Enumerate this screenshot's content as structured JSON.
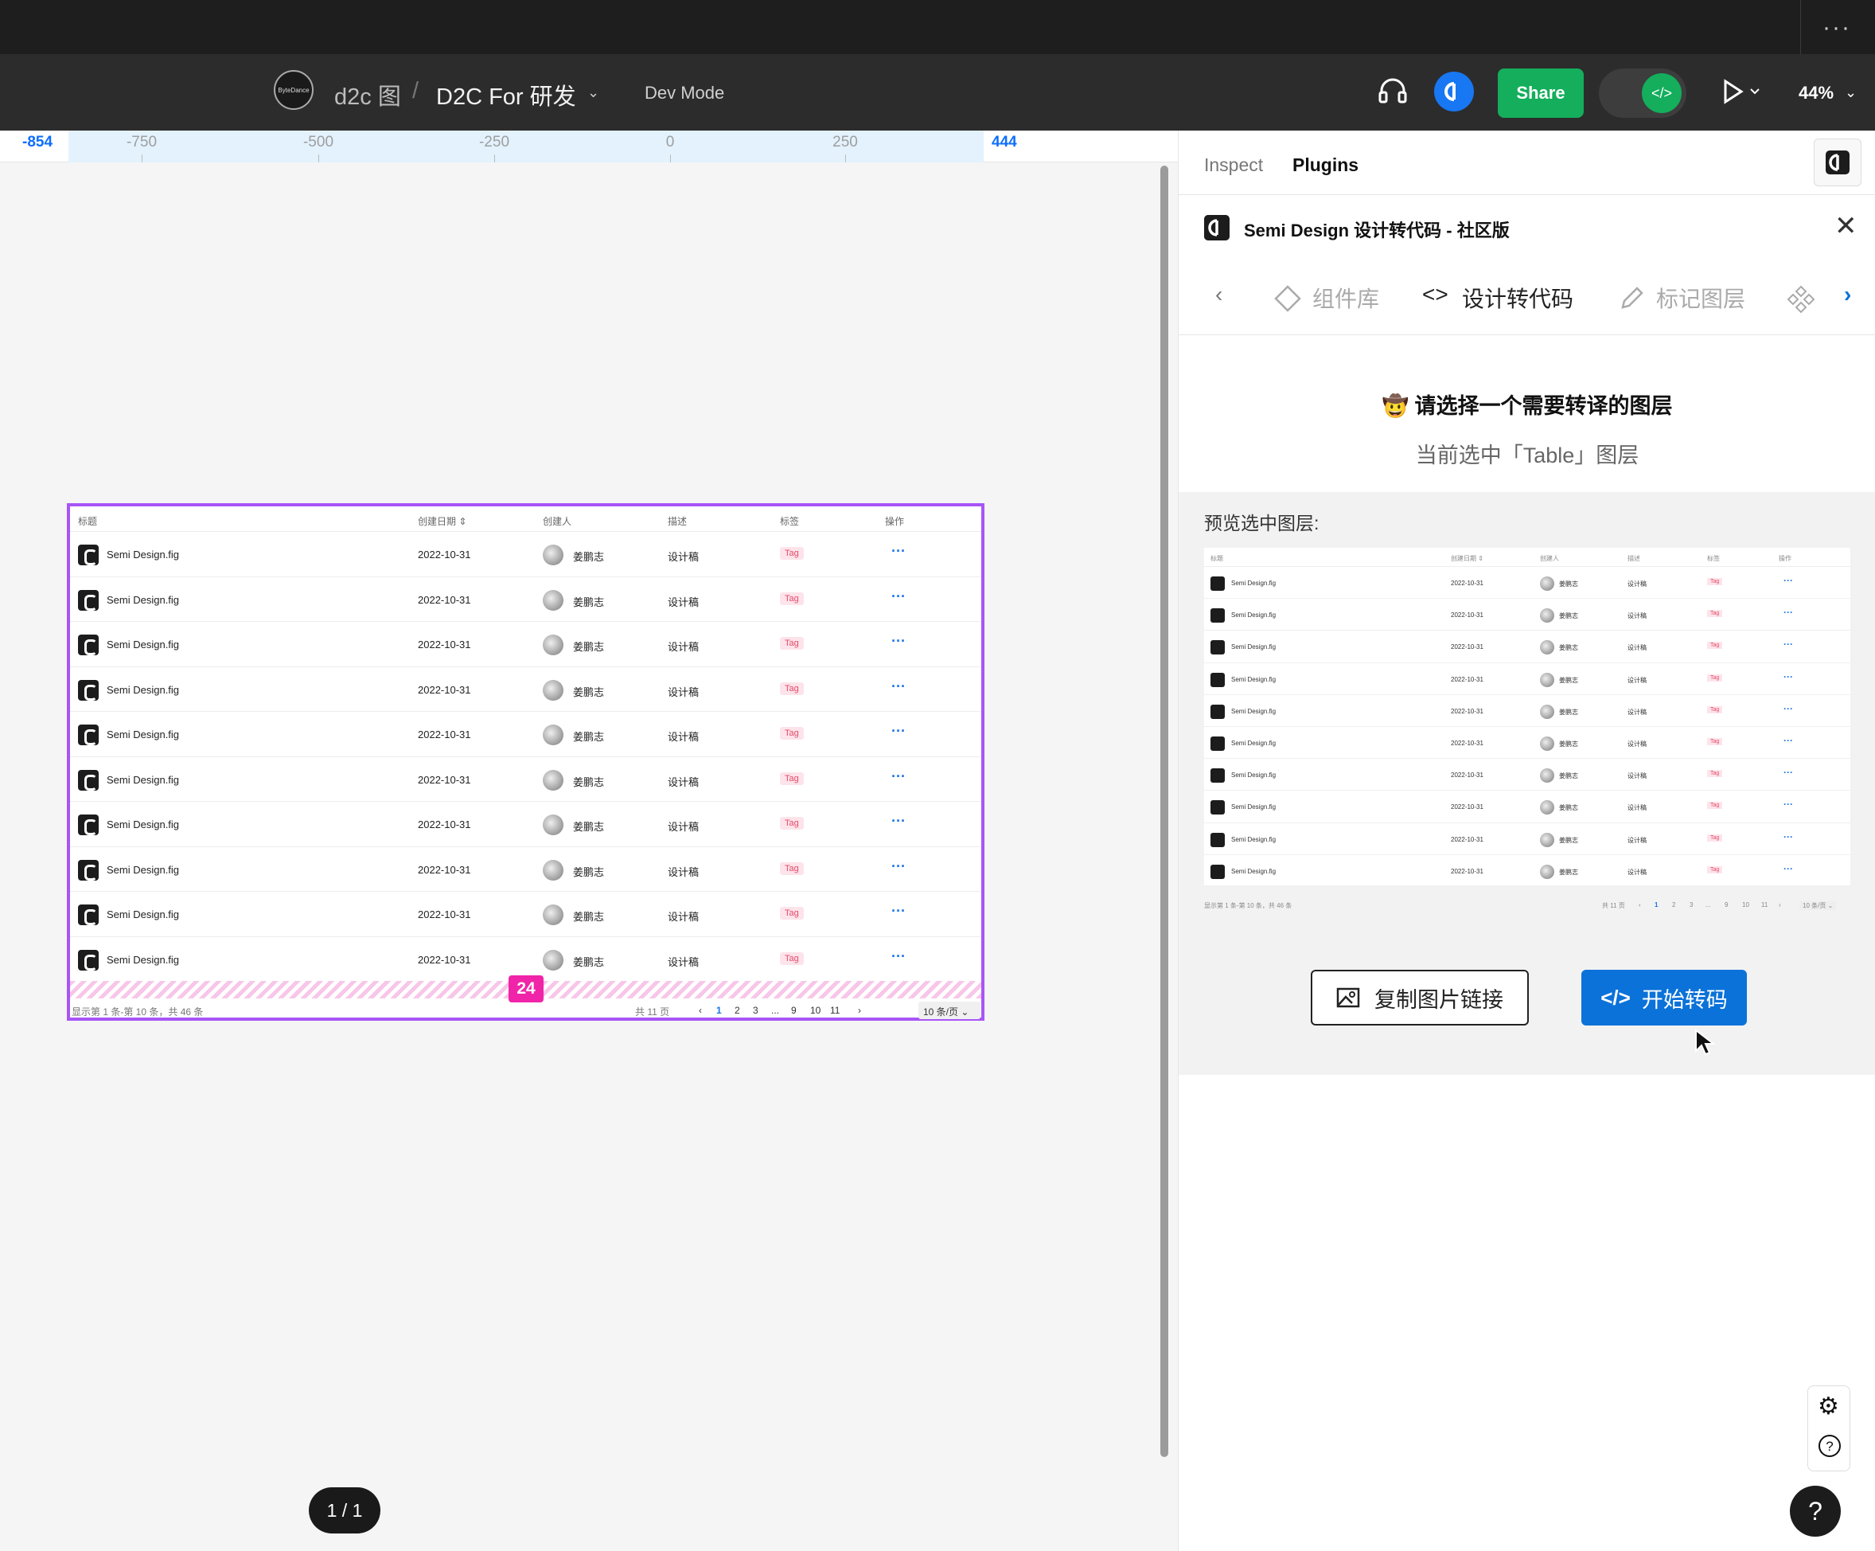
{
  "toolbar": {
    "logo_text": "ByteDance",
    "project": "d2c 图",
    "separator": "/",
    "file": "D2C For 研发",
    "mode": "Dev Mode",
    "share": "Share",
    "zoom": "44%"
  },
  "ruler": {
    "left_edge": "-854",
    "right_edge": "444",
    "ticks": [
      "-750",
      "-500",
      "-250",
      "0",
      "250"
    ]
  },
  "table": {
    "headers": [
      "标题",
      "创建日期 ⇕",
      "创建人",
      "描述",
      "标签",
      "操作"
    ],
    "rows": [
      {
        "title": "Semi Design.fig",
        "date": "2022-10-31",
        "user": "姜鹏志",
        "desc": "设计稿",
        "tag": "Tag",
        "op": "···"
      },
      {
        "title": "Semi Design.fig",
        "date": "2022-10-31",
        "user": "姜鹏志",
        "desc": "设计稿",
        "tag": "Tag",
        "op": "···"
      },
      {
        "title": "Semi Design.fig",
        "date": "2022-10-31",
        "user": "姜鹏志",
        "desc": "设计稿",
        "tag": "Tag",
        "op": "···"
      },
      {
        "title": "Semi Design.fig",
        "date": "2022-10-31",
        "user": "姜鹏志",
        "desc": "设计稿",
        "tag": "Tag",
        "op": "···"
      },
      {
        "title": "Semi Design.fig",
        "date": "2022-10-31",
        "user": "姜鹏志",
        "desc": "设计稿",
        "tag": "Tag",
        "op": "···"
      },
      {
        "title": "Semi Design.fig",
        "date": "2022-10-31",
        "user": "姜鹏志",
        "desc": "设计稿",
        "tag": "Tag",
        "op": "···"
      },
      {
        "title": "Semi Design.fig",
        "date": "2022-10-31",
        "user": "姜鹏志",
        "desc": "设计稿",
        "tag": "Tag",
        "op": "···"
      },
      {
        "title": "Semi Design.fig",
        "date": "2022-10-31",
        "user": "姜鹏志",
        "desc": "设计稿",
        "tag": "Tag",
        "op": "···"
      },
      {
        "title": "Semi Design.fig",
        "date": "2022-10-31",
        "user": "姜鹏志",
        "desc": "设计稿",
        "tag": "Tag",
        "op": "···"
      },
      {
        "title": "Semi Design.fig",
        "date": "2022-10-31",
        "user": "姜鹏志",
        "desc": "设计稿",
        "tag": "Tag",
        "op": "···"
      }
    ],
    "spacing_badge": "24",
    "footer_info": "显示第 1 条-第 10 条，共 46 条",
    "total_pages": "共 11 页",
    "pages": [
      "‹",
      "1",
      "2",
      "3",
      "...",
      "9",
      "10",
      "11",
      "›"
    ],
    "active_page": "1",
    "per_page": "10 条/页 ⌄"
  },
  "page_indicator": "1 / 1",
  "panel": {
    "tab_inspect": "Inspect",
    "tab_plugins": "Plugins",
    "plugin_title": "Semi Design 设计转代码 - 社区版",
    "nav_left": "‹",
    "nav_right": "›",
    "nav_items": [
      "组件库",
      "设计转代码",
      "标记图层"
    ],
    "active_nav": "设计转代码",
    "prompt": "🤠 请选择一个需要转译的图层",
    "selected": "当前选中「Table」图层",
    "preview_label": "预览选中图层:",
    "copy_button": "复制图片链接",
    "start_button": "开始转码"
  },
  "help": "?",
  "colors": {
    "accent_blue": "#0b72d9",
    "share_green": "#14ae5c",
    "frame_purple": "#a855f7",
    "badge_pink": "#f024a8"
  }
}
